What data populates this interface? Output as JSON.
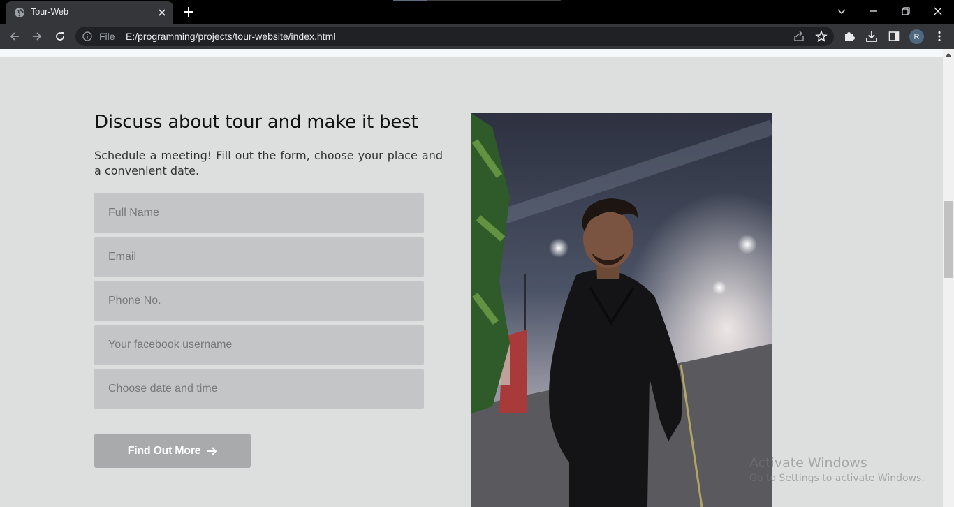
{
  "browser": {
    "tab_title": "Tour-Web",
    "omnibox_scheme": "File",
    "omnibox_url": "E:/programming/projects/tour-website/index.html",
    "profile_initial": "R"
  },
  "section": {
    "heading": "Discuss about tour and make it best",
    "subtext": "Schedule a meeting! Fill out the form, choose your place and a convenient date."
  },
  "form": {
    "full_name_placeholder": "Full Name",
    "email_placeholder": "Email",
    "phone_placeholder": "Phone No.",
    "facebook_placeholder": "Your facebook username",
    "datetime_placeholder": "Choose date and time",
    "submit_label": "Find Out More"
  },
  "watermark": {
    "title": "Activate Windows",
    "subtitle": "Go to Settings to activate Windows."
  },
  "colors": {
    "page_bg": "#dddfde",
    "field_bg": "#c3c5c6",
    "button_bg": "#a8aaab",
    "chrome_dark": "#35363a"
  }
}
